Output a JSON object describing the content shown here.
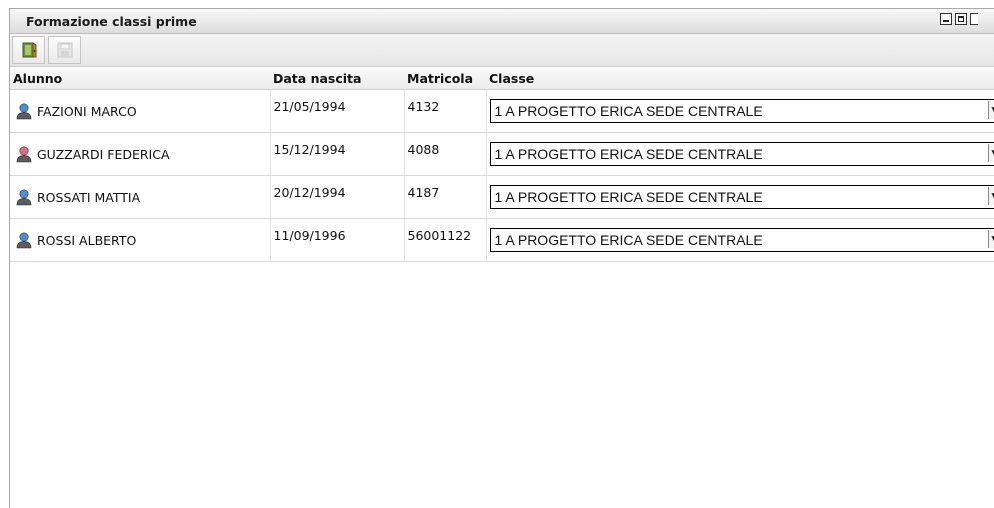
{
  "window": {
    "title": "Formazione classi prime",
    "controls": [
      "minimize",
      "maximize",
      "close"
    ]
  },
  "toolbar": {
    "buttons": [
      {
        "name": "exit",
        "icon": "exit-door-icon",
        "enabled": true
      },
      {
        "name": "save",
        "icon": "save-icon",
        "enabled": false
      }
    ]
  },
  "grid": {
    "columns": [
      "Alunno",
      "Data nascita",
      "Matricola",
      "Classe"
    ],
    "rows": [
      {
        "alunno": "FAZIONI MARCO",
        "gender": "male",
        "data_nascita": "21/05/1994",
        "matricola": "4132",
        "classe": "1 A PROGETTO ERICA SEDE CENTRALE"
      },
      {
        "alunno": "GUZZARDI FEDERICA",
        "gender": "female",
        "data_nascita": "15/12/1994",
        "matricola": "4088",
        "classe": "1 A PROGETTO ERICA SEDE CENTRALE"
      },
      {
        "alunno": "ROSSATI MATTIA",
        "gender": "male",
        "data_nascita": "20/12/1994",
        "matricola": "4187",
        "classe": "1 A PROGETTO ERICA SEDE CENTRALE"
      },
      {
        "alunno": "ROSSI ALBERTO",
        "gender": "male",
        "data_nascita": "11/09/1996",
        "matricola": "56001122",
        "classe": "1 A PROGETTO ERICA SEDE CENTRALE"
      }
    ]
  },
  "colors": {
    "male_avatar": "#4a8fd8",
    "female_avatar": "#e06a8a",
    "avatar_body": "#5c5c5c"
  }
}
